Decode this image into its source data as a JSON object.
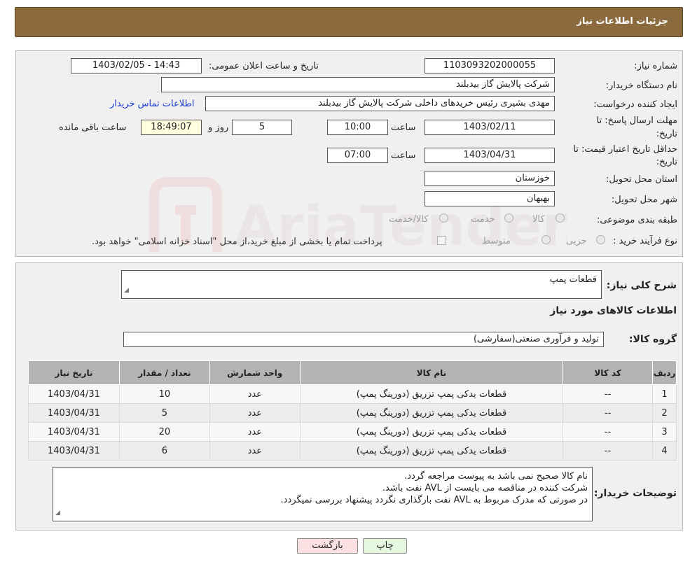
{
  "header": {
    "title": "جزئیات اطلاعات نیاز"
  },
  "form": {
    "need_number_label": "شماره نیاز:",
    "need_number": "1103093202000055",
    "announce_label": "تاریخ و ساعت اعلان عمومی:",
    "announce_value": "1403/02/05 - 14:43",
    "buyer_org_label": "نام دستگاه خریدار:",
    "buyer_org": "شرکت پالایش گاز بیدبلند",
    "creator_label": "ایجاد کننده درخواست:",
    "creator": "مهدی بشیری رئیس خریدهای داخلی شرکت پالایش گاز بیدبلند",
    "contact_link": "اطلاعات تماس خریدار",
    "deadline_label_1": "مهلت ارسال پاسخ: تا",
    "deadline_label_2": "تاریخ:",
    "deadline_date": "1403/02/11",
    "time_label": "ساعت",
    "deadline_time": "10:00",
    "days_value": "5",
    "days_label": "روز و",
    "remaining_time": "18:49:07",
    "remaining_label": "ساعت باقی مانده",
    "validity_label_1": "حداقل تاریخ اعتبار قیمت: تا",
    "validity_label_2": "تاریخ:",
    "validity_date": "1403/04/31",
    "validity_time": "07:00",
    "province_label": "استان محل تحویل:",
    "province": "خوزستان",
    "city_label": "شهر محل تحویل:",
    "city": "بهبهان",
    "category_label": "طبقه بندی موضوعی:",
    "category_options": [
      "کالا",
      "خدمت",
      "کالا/خدمت"
    ],
    "process_label": "نوع فرآیند خرید :",
    "process_options": [
      "جزیی",
      "متوسط"
    ],
    "payment_note": "پرداخت تمام یا بخشی از مبلغ خرید،از محل \"اسناد خزانه اسلامی\" خواهد بود."
  },
  "details": {
    "summary_label": "شرح کلی نیاز:",
    "summary": "قطعات پمپ",
    "goods_info_title": "اطلاعات کالاهای مورد نیاز",
    "goods_group_label": "گروه کالا:",
    "goods_group": "تولید و فرآوری صنعتی(سفارشی)"
  },
  "table": {
    "headers": [
      "ردیف",
      "کد کالا",
      "نام کالا",
      "واحد شمارش",
      "تعداد / مقدار",
      "تاریخ نیاز"
    ],
    "rows": [
      [
        "1",
        "--",
        "قطعات یدکی پمپ تزریق (دورینگ پمپ)",
        "عدد",
        "10",
        "1403/04/31"
      ],
      [
        "2",
        "--",
        "قطعات یدکی پمپ تزریق (دورینگ پمپ)",
        "عدد",
        "5",
        "1403/04/31"
      ],
      [
        "3",
        "--",
        "قطعات یدکی پمپ تزریق (دورینگ پمپ)",
        "عدد",
        "20",
        "1403/04/31"
      ],
      [
        "4",
        "--",
        "قطعات یدکی پمپ تزریق (دورینگ پمپ)",
        "عدد",
        "6",
        "1403/04/31"
      ]
    ]
  },
  "buyer_notes": {
    "label": "توضیحات خریدار:",
    "lines": [
      "نام کالا صحیح نمی باشد به پیوست مراجعه گردد.",
      "شرکت کننده در مناقصه می بایست از AVL نفت باشد.",
      "در صورتی که مدرک مربوط به AVL نفت بارگذاری نگردد پیشنهاد بررسی نمیگردد."
    ]
  },
  "buttons": {
    "print": "چاپ",
    "back": "بازگشت"
  },
  "watermark": {
    "text": "AriaTender.neT"
  },
  "colors": {
    "header_bg": "#8b6a3d",
    "link": "#1a3bd6",
    "table_header": "#b4b4b4"
  }
}
